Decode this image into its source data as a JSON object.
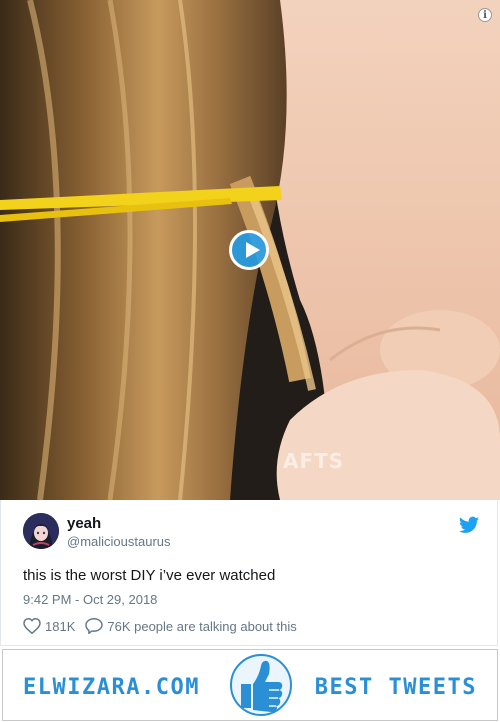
{
  "media": {
    "watermark": "AFTS",
    "info_icon": "info-icon",
    "play_icon": "play-icon"
  },
  "tweet": {
    "display_name": "yeah",
    "handle": "@malicioustaurus",
    "text": "this is the worst DIY i’ve ever watched",
    "timestamp": "9:42 PM - Oct 29, 2018",
    "likes": "181K",
    "replies_text": "76K people are talking about this"
  },
  "footer": {
    "brand": "ELWIZARA.COM",
    "tagline": "BEST TWEETS"
  },
  "colors": {
    "twitter_blue": "#1da1f2",
    "brand_blue": "#2b8fd6"
  }
}
